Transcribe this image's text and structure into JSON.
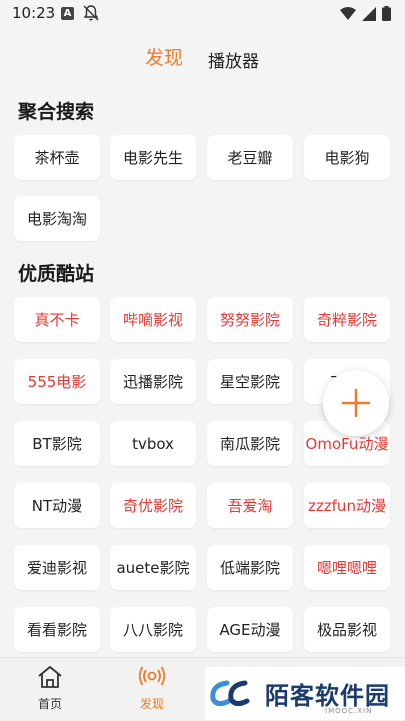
{
  "status_bar": {
    "time": "10:23",
    "a_badge": "A"
  },
  "top_tabs": {
    "discover": "发现",
    "player": "播放器"
  },
  "aggregate": {
    "title": "聚合搜索",
    "items": [
      "茶杯壶",
      "电影先生",
      "老豆瓣",
      "电影狗",
      "电影淘淘"
    ]
  },
  "quality": {
    "title": "优质酷站",
    "items": [
      {
        "label": "真不卡",
        "red": true
      },
      {
        "label": "哔嘀影视",
        "red": true
      },
      {
        "label": "努努影院",
        "red": true
      },
      {
        "label": "奇粹影院",
        "red": true
      },
      {
        "label": "555电影",
        "red": true
      },
      {
        "label": "迅播影院",
        "red": false
      },
      {
        "label": "星空影院",
        "red": false
      },
      {
        "label": "TV...",
        "red": false
      },
      {
        "label": "BT影院",
        "red": false
      },
      {
        "label": "tvbox",
        "red": false
      },
      {
        "label": "南瓜影院",
        "red": false
      },
      {
        "label": "OmoFu动漫",
        "red": true
      },
      {
        "label": "NT动漫",
        "red": false
      },
      {
        "label": "奇优影院",
        "red": true
      },
      {
        "label": "吾爱淘",
        "red": true
      },
      {
        "label": "zzzfun动漫",
        "red": true
      },
      {
        "label": "爱迪影视",
        "red": false
      },
      {
        "label": "auete影院",
        "red": false
      },
      {
        "label": "低端影院",
        "red": false
      },
      {
        "label": "嗯哩嗯哩",
        "red": true
      },
      {
        "label": "看看影院",
        "red": false
      },
      {
        "label": "八八影院",
        "red": false
      },
      {
        "label": "AGE动漫",
        "red": false
      },
      {
        "label": "极品影视",
        "red": false
      }
    ]
  },
  "bottom_nav": {
    "home": "首页",
    "discover": "发现"
  },
  "watermark": {
    "text": "陌客软件园",
    "sub": "IMOOC.XIN"
  },
  "colors": {
    "accent": "#f07b2a",
    "red": "#e53935"
  }
}
